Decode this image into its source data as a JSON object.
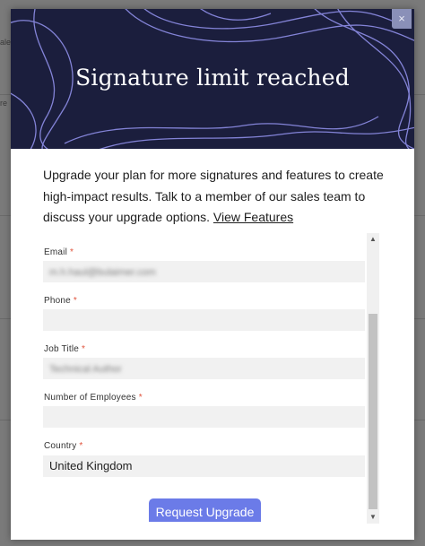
{
  "background": {
    "fragments": [
      "ale",
      "re"
    ]
  },
  "modal": {
    "title": "Signature limit reached",
    "close_label": "×",
    "intro_text": "Upgrade your plan for more signatures and features to create high-impact results. Talk to a member of our sales team to discuss your upgrade options.",
    "view_features_link": "View Features",
    "required_marker": "*",
    "fields": [
      {
        "label": "Email",
        "value": "m.h.haul@bulaimer.com",
        "blurred": true
      },
      {
        "label": "Phone",
        "value": "",
        "blurred": false
      },
      {
        "label": "Job Title",
        "value": "Technical Author",
        "blurred": true
      },
      {
        "label": "Number of Employees",
        "value": "",
        "blurred": false
      },
      {
        "label": "Country",
        "value": "United Kingdom",
        "blurred": false
      }
    ],
    "submit_label": "Request Upgrade"
  },
  "colors": {
    "hero_bg": "#1b1e3d",
    "accent_button": "#6b7be8",
    "required": "#e0533c"
  }
}
